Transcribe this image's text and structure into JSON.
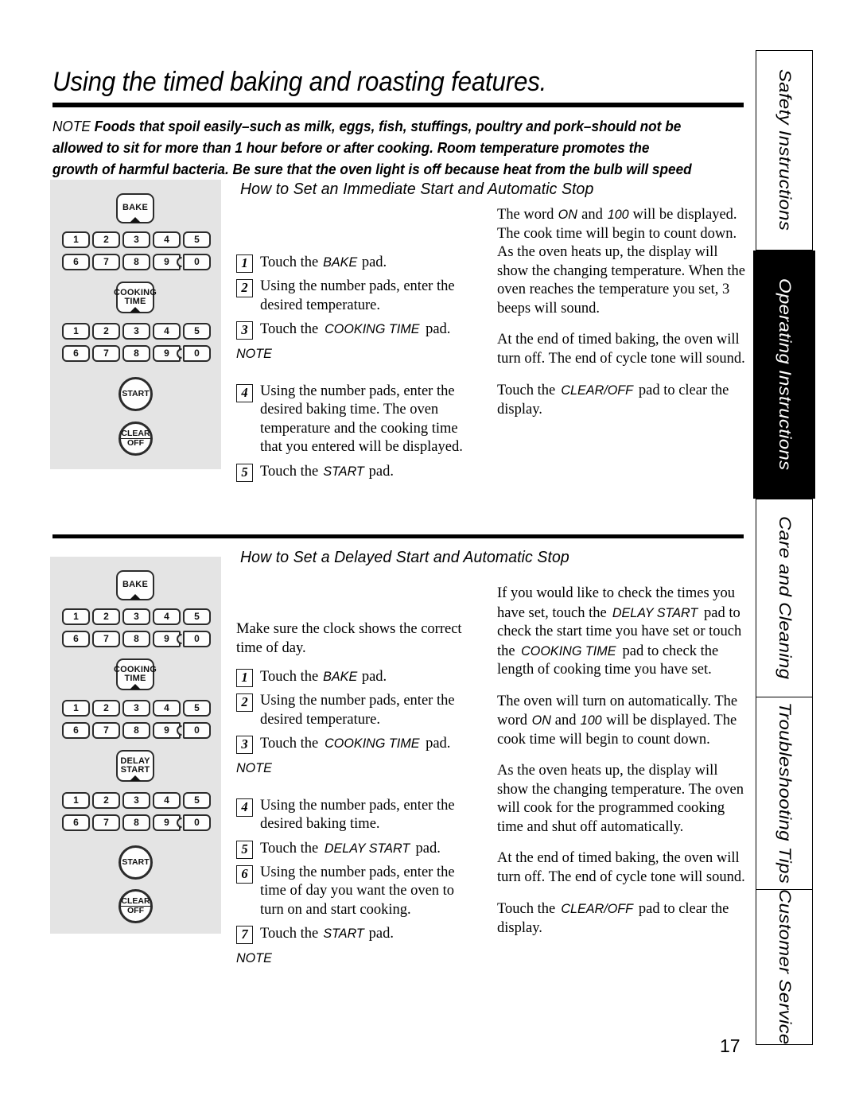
{
  "page": {
    "title": "Using the timed baking and roasting features.",
    "page_number": "17",
    "note_label": "NOTE",
    "note_body": "Foods that spoil easily–such as milk, eggs, fish, stuffings, poultry and pork–should not be allowed to sit for more than 1 hour before or after cooking. Room temperature promotes the growth of harmful bacteria. Be sure that the oven light is off because heat from the bulb will speed harmful bacteria growth."
  },
  "tabs": [
    {
      "label": "Safety Instructions",
      "active": false
    },
    {
      "label": "Operating Instructions",
      "active": true
    },
    {
      "label": "Care and Cleaning",
      "active": false
    },
    {
      "label": "Troubleshooting Tips",
      "active": false
    },
    {
      "label": "Customer Service",
      "active": false
    }
  ],
  "sections": [
    {
      "heading": "How to Set an Immediate Start and Automatic Stop",
      "panel": {
        "pads": [
          "BAKE",
          "COOKING TIME"
        ],
        "numbers": [
          "1",
          "2",
          "3",
          "4",
          "5",
          "6",
          "7",
          "8",
          "9",
          "0"
        ],
        "start_label": "START",
        "clear_label_line1": "CLEAR",
        "clear_label_line2": "OFF"
      },
      "steps": [
        {
          "num": "1",
          "text_before": "Touch the ",
          "keyword": "BAKE",
          "text_after": " pad."
        },
        {
          "num": "2",
          "text_before": "Using the number pads, enter the desired temperature.",
          "keyword": "",
          "text_after": ""
        },
        {
          "num": "3",
          "text_before": "Touch the ",
          "keyword": "COOKING TIME",
          "text_after": " pad."
        },
        {
          "num": "4",
          "text_before": "Using the number pads, enter the desired baking time. The oven temperature and the cooking time that you entered will be displayed.",
          "keyword": "",
          "text_after": ""
        },
        {
          "num": "5",
          "text_before": "Touch the ",
          "keyword": "START",
          "text_after": " pad."
        }
      ],
      "note_marker": "NOTE",
      "right_paragraphs": [
        {
          "a": "The word ",
          "kw": "ON",
          "b": " and ",
          "kw2": "100",
          "c": "  will be displayed. The cook time will begin to count down. As the oven heats up, the display will show the changing temperature. When the oven reaches the temperature you set, 3 beeps will sound."
        },
        {
          "a": "At the end of timed baking, the oven will turn off. The end of cycle tone will sound.",
          "kw": "",
          "b": "",
          "kw2": "",
          "c": ""
        },
        {
          "a": "Touch the ",
          "kw": "CLEAR/OFF",
          "b": " pad to clear the display.",
          "kw2": "",
          "c": ""
        }
      ]
    },
    {
      "heading": "How to Set a Delayed Start and Automatic Stop",
      "panel": {
        "pads": [
          "BAKE",
          "COOKING TIME",
          "DELAY START"
        ],
        "numbers": [
          "1",
          "2",
          "3",
          "4",
          "5",
          "6",
          "7",
          "8",
          "9",
          "0"
        ],
        "start_label": "START",
        "clear_label_line1": "CLEAR",
        "clear_label_line2": "OFF"
      },
      "intro": "Make sure the clock shows the correct time of day.",
      "steps": [
        {
          "num": "1",
          "text_before": "Touch the ",
          "keyword": "BAKE",
          "text_after": " pad."
        },
        {
          "num": "2",
          "text_before": "Using the number pads, enter the desired temperature.",
          "keyword": "",
          "text_after": ""
        },
        {
          "num": "3",
          "text_before": "Touch the ",
          "keyword": "COOKING TIME",
          "text_after": " pad."
        },
        {
          "num": "4",
          "text_before": "Using the number pads, enter the desired baking time.",
          "keyword": "",
          "text_after": ""
        },
        {
          "num": "5",
          "text_before": "Touch the ",
          "keyword": "DELAY START",
          "text_after": " pad."
        },
        {
          "num": "6",
          "text_before": "Using the number pads, enter the time of day you want the oven to turn on and start cooking.",
          "keyword": "",
          "text_after": ""
        },
        {
          "num": "7",
          "text_before": "Touch the ",
          "keyword": "START",
          "text_after": " pad."
        }
      ],
      "note_marker": "NOTE",
      "note_marker_2": "NOTE",
      "right_paragraphs": [
        {
          "a": "If you would like to check the times you have set, touch the ",
          "kw": "DELAY START",
          "b": " pad to check the start time you have set or touch the ",
          "kw2": "COOKING TIME",
          "c": " pad to check the length of cooking time you have set."
        },
        {
          "a": "The oven will turn on automatically. The word ",
          "kw": "ON",
          "b": " and ",
          "kw2": "100",
          "c": "  will be displayed. The cook time will begin to count down."
        },
        {
          "a": "As the oven heats up, the display will show the changing temperature. The oven will cook for the programmed cooking time and shut off automatically.",
          "kw": "",
          "b": "",
          "kw2": "",
          "c": ""
        },
        {
          "a": "At the end of timed baking, the oven will turn off. The end of cycle tone will sound.",
          "kw": "",
          "b": "",
          "kw2": "",
          "c": ""
        },
        {
          "a": "Touch the ",
          "kw": "CLEAR/OFF",
          "b": " pad to clear the display.",
          "kw2": "",
          "c": ""
        }
      ]
    }
  ]
}
